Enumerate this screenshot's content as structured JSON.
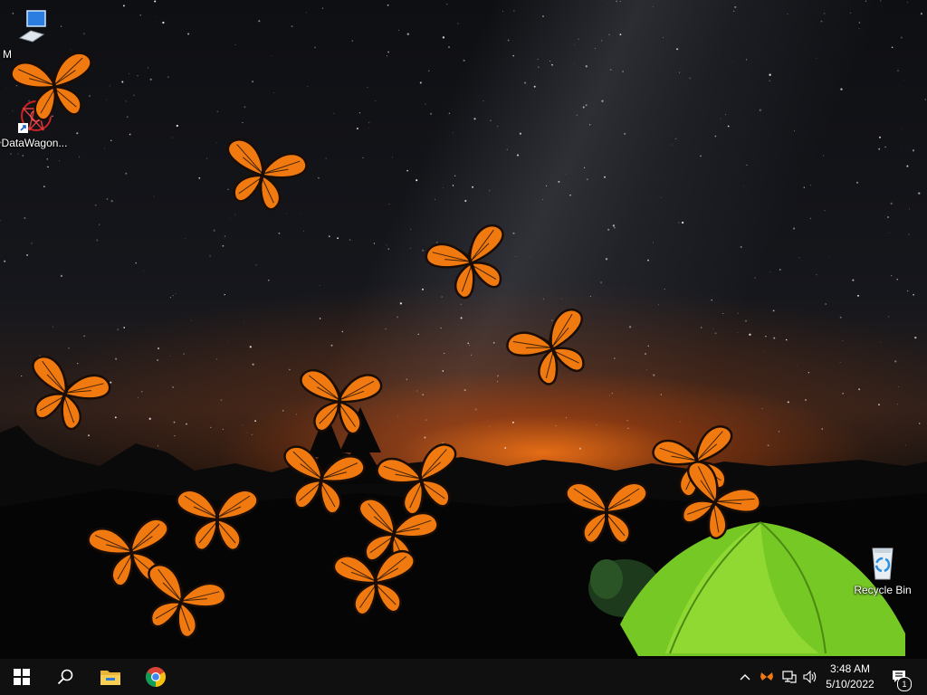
{
  "desktop": {
    "icons": [
      {
        "label": "M",
        "icon": "this-pc-icon"
      },
      {
        "label": "DataWagon...",
        "icon": "datawagon-icon"
      },
      {
        "label": "Recycle Bin",
        "icon": "recycle-bin-icon"
      }
    ],
    "wallpaper": "night-sky-tent-wallpaper",
    "butterfly_count": 16
  },
  "taskbar": {
    "pinned": [
      {
        "name": "start-button",
        "icon": "windows-logo-icon"
      },
      {
        "name": "search-button",
        "icon": "search-icon"
      },
      {
        "name": "file-explorer-button",
        "icon": "folder-icon"
      },
      {
        "name": "chrome-button",
        "icon": "chrome-icon"
      }
    ],
    "tray": {
      "icons": [
        "chevron-up-icon",
        "butterfly-tray-icon",
        "network-icon",
        "volume-icon"
      ],
      "time": "3:48 AM",
      "date": "5/10/2022",
      "notification_count": "1"
    }
  },
  "colors": {
    "taskbar_bg": "#101010",
    "butterfly_orange": "#F07A10",
    "tent_green": "#7ED321"
  }
}
